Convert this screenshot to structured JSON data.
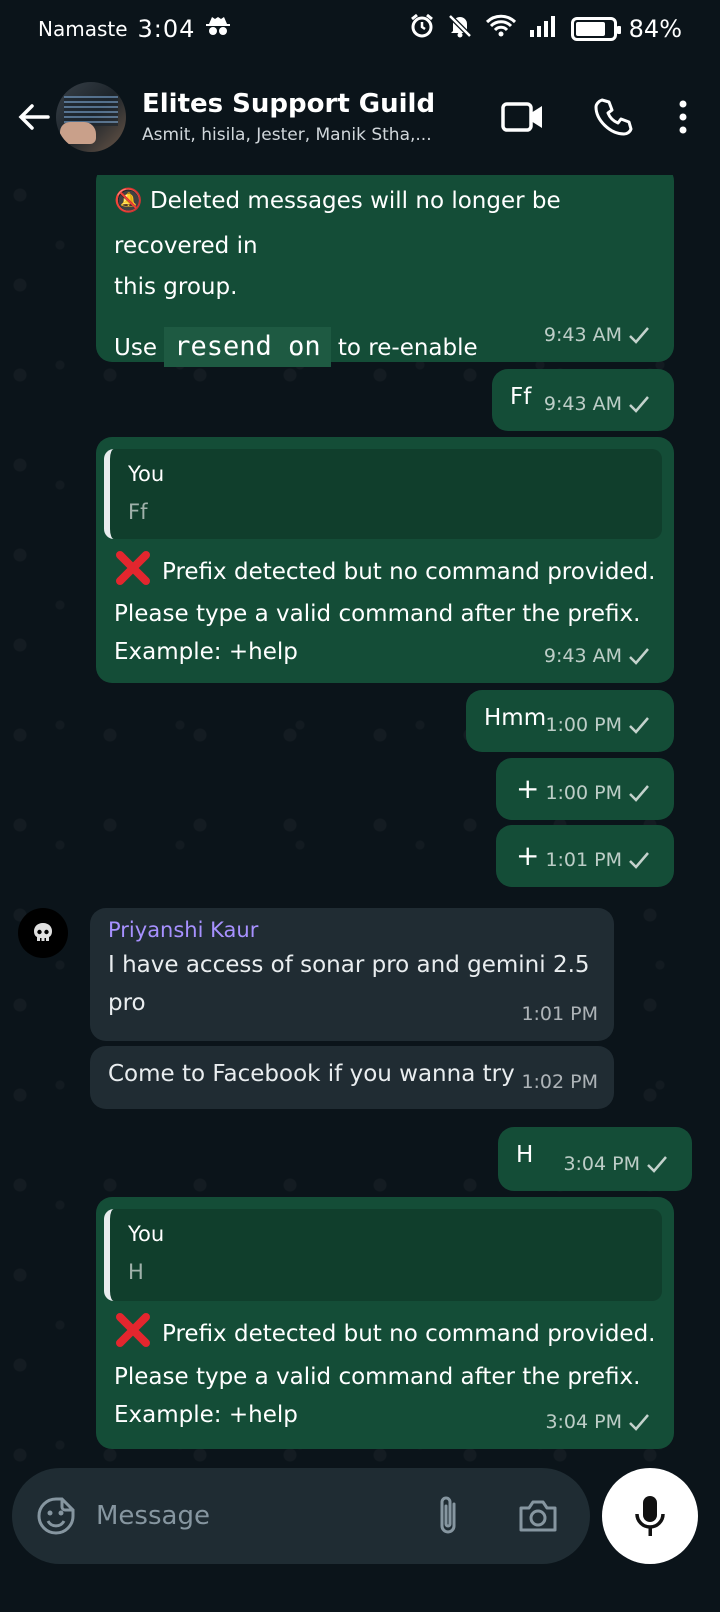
{
  "status_bar": {
    "carrier": "Namaste",
    "time": "3:04",
    "battery": "84%",
    "battery_level": 0.84,
    "icons": [
      "spy-icon",
      "alarm-icon",
      "mute-icon",
      "wifi-icon",
      "signal-icon",
      "battery-icon"
    ]
  },
  "header": {
    "title": "Elites Support Guild",
    "members": "Asmit, hisila, Jester, Manik Stha,...",
    "icons": [
      "back-arrow-icon",
      "video-call-icon",
      "phone-icon",
      "more-vert-icon"
    ]
  },
  "messages": {
    "m1": {
      "emoji": "🔕",
      "line1": "Deleted messages will no longer be recovered in",
      "line2": "this group.",
      "use": "Use",
      "code": "resend on",
      "tail": "to re-enable",
      "time": "9:43 AM"
    },
    "m2": {
      "text": "Ff",
      "time": "9:43 AM"
    },
    "m3": {
      "quote_name": "You",
      "quote_text": "Ff",
      "line1": "Prefix detected but no command provided.",
      "line2": "Please type a valid command after the prefix.",
      "line3": "Example: +help",
      "time": "9:43 AM"
    },
    "m4": {
      "text": "Hmm",
      "time": "1:00 PM"
    },
    "m5": {
      "text": "+",
      "time": "1:00 PM"
    },
    "m6": {
      "text": "+",
      "time": "1:01 PM"
    },
    "m7": {
      "sender": "Priyanshi Kaur",
      "line1": "I have access of sonar pro and gemini 2.5",
      "line2": "pro",
      "time": "1:01 PM"
    },
    "m8": {
      "text": "Come to Facebook if you wanna try",
      "time": "1:02 PM"
    },
    "m9": {
      "text": "H",
      "time": "3:04 PM"
    },
    "m10": {
      "quote_name": "You",
      "quote_text": "H",
      "line1": "Prefix detected but no command provided.",
      "line2": "Please type a valid command after the prefix.",
      "line3": "Example: +help",
      "time": "3:04 PM"
    }
  },
  "composer": {
    "placeholder": "Message",
    "icons": [
      "sticker-icon",
      "attach-icon",
      "camera-icon",
      "mic-icon"
    ]
  },
  "colors": {
    "background": "#0b141a",
    "outgoing_bubble": "#144d37",
    "incoming_bubble": "#202c33",
    "sender_name": "#a791ff"
  }
}
